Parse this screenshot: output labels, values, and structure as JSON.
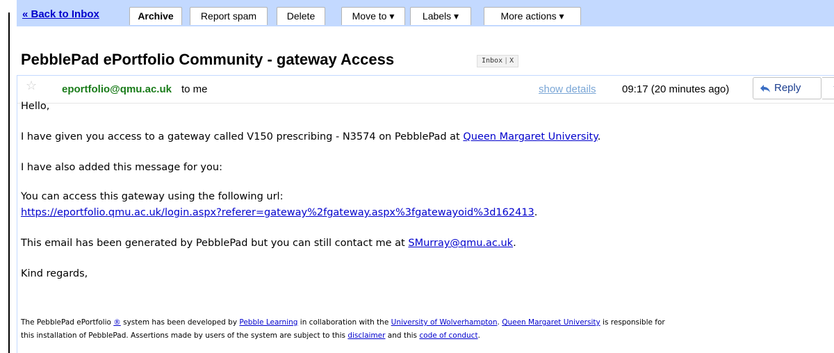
{
  "toolbar": {
    "back_label": "« Back to Inbox",
    "archive_label": "Archive",
    "report_spam_label": "Report spam",
    "delete_label": "Delete",
    "move_to_label": "Move to ▾",
    "labels_label": "Labels ▾",
    "more_actions_label": "More actions ▾"
  },
  "subject": {
    "title": "PebblePad ePortfolio Community - gateway Access",
    "label_inbox": "Inbox",
    "label_remove": "X"
  },
  "header": {
    "sender": "eportfolio@qmu.ac.uk",
    "to": "to me",
    "show_details": "show details",
    "timestamp": "09:17 (20 minutes ago)",
    "reply": "Reply",
    "more_arrow": "▼"
  },
  "body": {
    "greeting": "Hello,",
    "p1_text": "I have given you access to a gateway called V150 prescribing - N3574 on PebblePad at ",
    "p1_link": "Queen Margaret University",
    "p1_end": ".",
    "p2": "I have also added this message for you:",
    "p3_text": "You can access this gateway using the following url:",
    "p3_link": "https://eportfolio.qmu.ac.uk/login.aspx?referer=gateway%2fgateway.aspx%3fgatewayoid%3d162413",
    "p3_end": ".",
    "p4_text": "This email has been generated by PebblePad but you can still contact me at ",
    "p4_link": "SMurray@qmu.ac.uk",
    "p4_end": ".",
    "closing": "Kind regards,"
  },
  "footer": {
    "t1": "The PebblePad ePortfolio ",
    "l1": "®",
    "t2": " system has been developed by ",
    "l2": "Pebble Learning",
    "t3": " in collaboration with the ",
    "l3": "University of Wolverhampton",
    "t4": ". ",
    "l4": "Queen Margaret University",
    "t5": " is responsible for",
    "t6": "this installation of PebblePad. Assertions made by users of the system are subject to this ",
    "l5": "disclaimer",
    "t7": " and this ",
    "l6": "code of conduct",
    "t8": "."
  },
  "colors": {
    "toolbar_bg": "#c3d9ff",
    "link": "#0000cc",
    "sender": "#1a7c1a"
  }
}
